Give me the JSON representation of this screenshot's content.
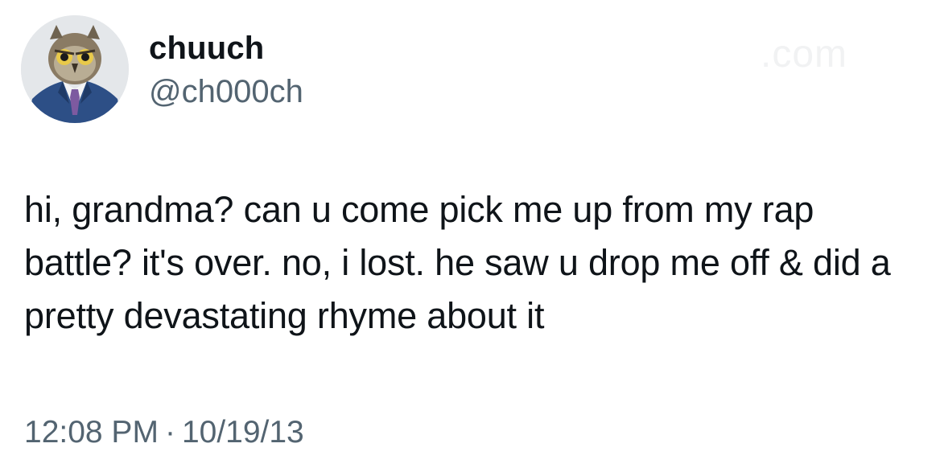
{
  "author": {
    "display_name": "chuuch",
    "handle": "@ch000ch",
    "avatar_icon": "owl-in-suit-avatar-icon"
  },
  "watermark": ".com",
  "tweet": {
    "text": "hi, grandma? can u come pick me up from my rap battle? it's over. no, i lost. he saw u drop me off & did a pretty devastating rhyme about it",
    "time": "12:08 PM",
    "separator": "·",
    "date": "10/19/13"
  },
  "colors": {
    "text": "#0f1419",
    "secondary": "#536471",
    "background": "#ffffff"
  }
}
